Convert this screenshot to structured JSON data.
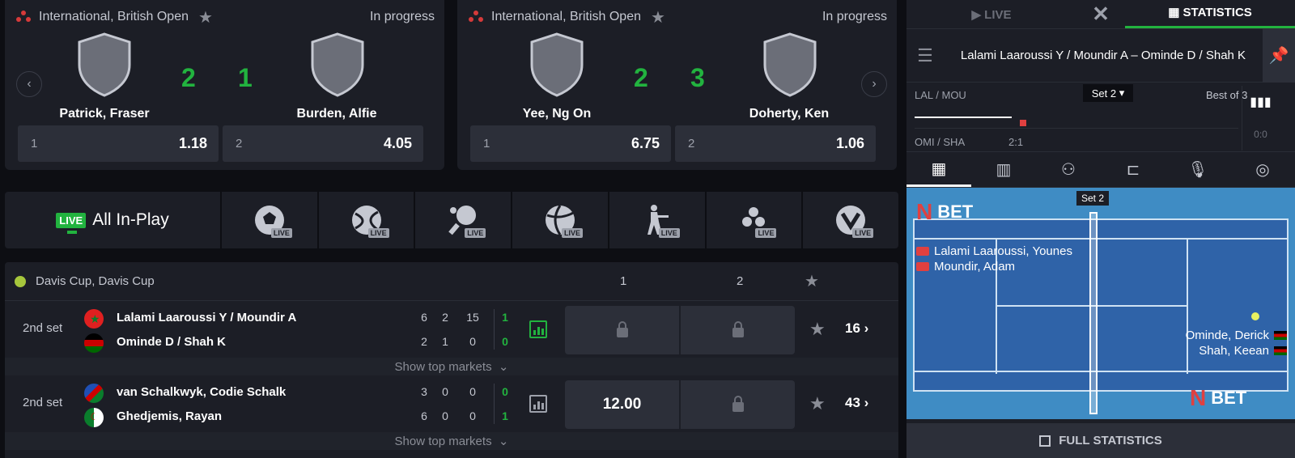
{
  "cards": [
    {
      "category": "International, British Open",
      "status": "In progress",
      "home": {
        "name": "Patrick, Fraser",
        "score": "2"
      },
      "away": {
        "name": "Burden, Alfie",
        "score": "1"
      },
      "odds": [
        {
          "pos": "1",
          "value": "1.18"
        },
        {
          "pos": "2",
          "value": "4.05"
        }
      ]
    },
    {
      "category": "International, British Open",
      "status": "In progress",
      "home": {
        "name": "Yee, Ng On",
        "score": "2"
      },
      "away": {
        "name": "Doherty, Ken",
        "score": "3"
      },
      "odds": [
        {
          "pos": "1",
          "value": "6.75"
        },
        {
          "pos": "2",
          "value": "1.06"
        }
      ]
    }
  ],
  "sport_strip": {
    "live_badge": "LIVE",
    "all_label": "All In-Play",
    "sports": [
      {
        "icon": "football-icon",
        "badge": "LIVE"
      },
      {
        "icon": "tennis-icon",
        "badge": "LIVE"
      },
      {
        "icon": "table-tennis-icon",
        "badge": "LIVE"
      },
      {
        "icon": "volleyball-icon",
        "badge": "LIVE"
      },
      {
        "icon": "esports-shooter-icon",
        "badge": "LIVE"
      },
      {
        "icon": "snooker-icon",
        "badge": "LIVE"
      },
      {
        "icon": "esports-valorant-icon",
        "badge": "LIVE"
      }
    ]
  },
  "events": {
    "tournament": "Davis Cup, Davis Cup",
    "col1": "1",
    "col2": "2",
    "rows": [
      {
        "period": "2nd set",
        "team1": "Lalami Laaroussi Y / Moundir A",
        "team2": "Ominde D / Shah K",
        "scores1": [
          "6",
          "2",
          "15",
          "1"
        ],
        "scores2": [
          "2",
          "1",
          "0",
          "0"
        ],
        "odd1": "",
        "odd2": "",
        "count": "16",
        "show_top": "Show top markets"
      },
      {
        "period": "2nd set",
        "team1": "van Schalkwyk, Codie Schalk",
        "team2": "Ghedjemis, Rayan",
        "scores1": [
          "3",
          "0",
          "0",
          "0"
        ],
        "scores2": [
          "6",
          "0",
          "0",
          "1"
        ],
        "odd1": "12.00",
        "odd2": "",
        "count": "43",
        "show_top": "Show top markets"
      }
    ]
  },
  "panel": {
    "tab_live": "LIVE",
    "tab_stats": "STATISTICS",
    "match_title": "Lalami Laaroussi Y / Moundir A – Ominde D / Shah K",
    "momentum": {
      "team_top": "LAL / MOU",
      "team_bottom": "OMI / SHA",
      "set_select": "Set 2",
      "best_of": "Best of 3",
      "score": "2:1",
      "mini": "0:0"
    },
    "court": {
      "set_label": "Set 2",
      "brand": "BET",
      "team1": [
        "Lalami Laaroussi, Younes",
        "Moundir, Adam"
      ],
      "team2": [
        "Ominde, Derick",
        "Shah, Keean"
      ]
    },
    "full_stats": "FULL STATISTICS"
  },
  "colors": {
    "bg": "#0d0e13",
    "surface": "#1c1e26",
    "button": "#2c2f39",
    "accent_green": "#22b33f",
    "brand_red": "#e04040",
    "court_blue": "#2f63a8"
  }
}
